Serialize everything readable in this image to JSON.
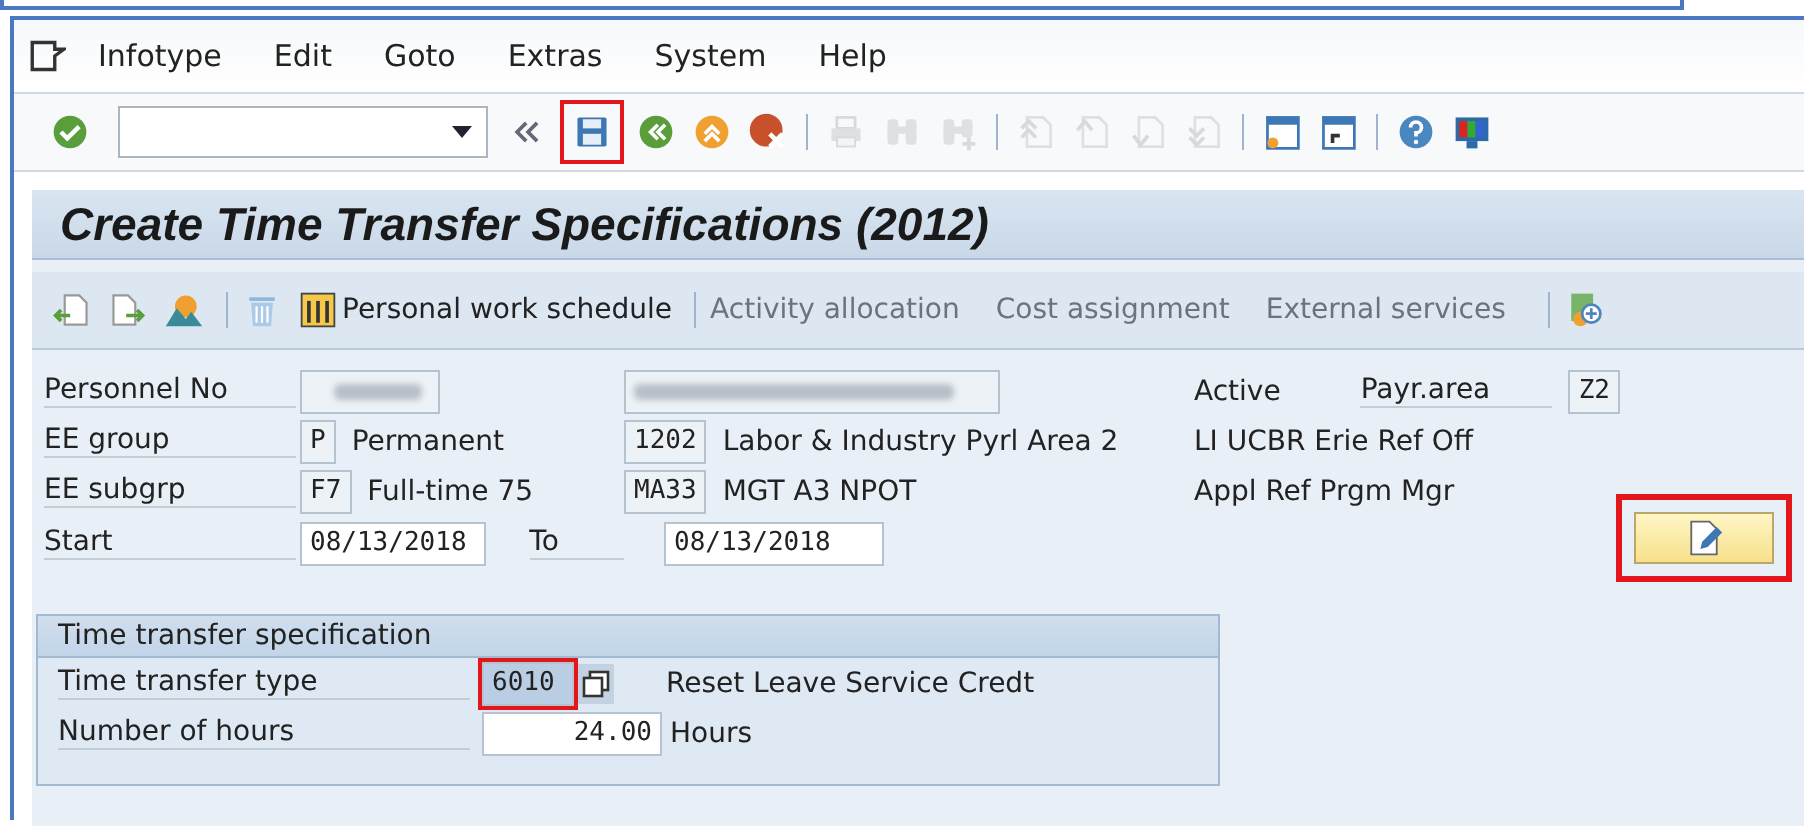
{
  "menu": [
    {
      "label": "Infotype"
    },
    {
      "label": "Edit"
    },
    {
      "label": "Goto"
    },
    {
      "label": "Extras"
    },
    {
      "label": "System"
    },
    {
      "label": "Help"
    }
  ],
  "toolbar": [
    {
      "kind": "enter",
      "disabled": false,
      "highlighted": false
    },
    {
      "kind": "command-field",
      "disabled": false,
      "highlighted": false
    },
    {
      "kind": "collapse",
      "disabled": false,
      "highlighted": false
    },
    {
      "kind": "save",
      "disabled": false,
      "highlighted": true
    },
    {
      "kind": "back",
      "disabled": false,
      "highlighted": false
    },
    {
      "kind": "exit",
      "disabled": false,
      "highlighted": false
    },
    {
      "kind": "cancel",
      "disabled": false,
      "highlighted": false
    },
    {
      "kind": "separator",
      "disabled": false,
      "highlighted": false
    },
    {
      "kind": "print",
      "disabled": true,
      "highlighted": false
    },
    {
      "kind": "find",
      "disabled": true,
      "highlighted": false
    },
    {
      "kind": "find-next",
      "disabled": true,
      "highlighted": false
    },
    {
      "kind": "separator",
      "disabled": false,
      "highlighted": false
    },
    {
      "kind": "first-page",
      "disabled": true,
      "highlighted": false
    },
    {
      "kind": "prev-page",
      "disabled": true,
      "highlighted": false
    },
    {
      "kind": "next-page",
      "disabled": true,
      "highlighted": false
    },
    {
      "kind": "last-page",
      "disabled": true,
      "highlighted": false
    },
    {
      "kind": "separator",
      "disabled": false,
      "highlighted": false
    },
    {
      "kind": "new-session",
      "disabled": false,
      "highlighted": false
    },
    {
      "kind": "shortcut",
      "disabled": false,
      "highlighted": false
    },
    {
      "kind": "separator",
      "disabled": false,
      "highlighted": false
    },
    {
      "kind": "help",
      "disabled": false,
      "highlighted": false
    },
    {
      "kind": "layout",
      "disabled": false,
      "highlighted": false
    }
  ],
  "title": "Create Time Transfer Specifications (2012)",
  "app_toolbar": [
    {
      "kind": "prev-record",
      "disabled": false
    },
    {
      "kind": "next-record",
      "disabled": false
    },
    {
      "kind": "overview",
      "disabled": false
    },
    {
      "kind": "separator",
      "disabled": false
    },
    {
      "kind": "delete",
      "disabled": false
    },
    {
      "kind": "schedule",
      "label": "Personal work schedule",
      "disabled": false
    },
    {
      "kind": "separator",
      "disabled": false
    },
    {
      "kind": "text",
      "label": "Activity allocation",
      "disabled": true
    },
    {
      "kind": "text",
      "label": "Cost assignment",
      "disabled": true
    },
    {
      "kind": "text",
      "label": "External services",
      "disabled": true
    },
    {
      "kind": "separator",
      "disabled": false
    },
    {
      "kind": "more-data",
      "disabled": false
    }
  ],
  "header": {
    "personnel_no": {
      "label": "Personnel No"
    },
    "status": "Active",
    "payroll_area": {
      "label": "Payr.area",
      "value": "Z2"
    },
    "ee_group": {
      "label": "EE group",
      "code": "P",
      "text": "Permanent"
    },
    "personnel_area": {
      "code": "1202",
      "text": "Labor & Industry Pyrl Area 2"
    },
    "org_unit": "LI UCBR Erie Ref Off",
    "ee_subgroup": {
      "label": "EE subgrp",
      "code": "F7",
      "text": "Full-time 75"
    },
    "subarea": {
      "code": "MA33",
      "text": "MGT A3 NPOT"
    },
    "position": "Appl Ref Prgm Mgr",
    "start": {
      "label": "Start",
      "value": "08/13/2018"
    },
    "to": {
      "label": "To",
      "value": "08/13/2018"
    },
    "edit_button": {
      "highlighted": true
    }
  },
  "group": {
    "title": "Time transfer specification",
    "rows": [
      {
        "kind": "code",
        "label": "Time transfer type",
        "value": "6010",
        "focused": true,
        "text": "Reset Leave Service Credt"
      },
      {
        "kind": "amount",
        "label": "Number of hours",
        "value": "24.00",
        "focused": false,
        "text": "Hours"
      }
    ]
  }
}
